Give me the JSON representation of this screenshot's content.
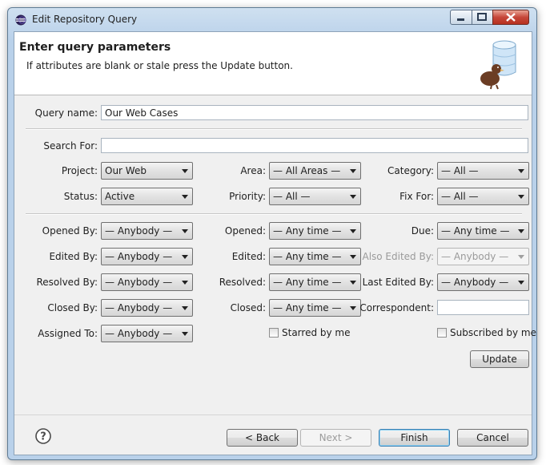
{
  "window": {
    "title": "Edit Repository Query"
  },
  "banner": {
    "title": "Enter query parameters",
    "description": "If attributes are blank or stale press the Update button."
  },
  "query_name": {
    "label": "Query name:",
    "value": "Our Web Cases"
  },
  "search_for": {
    "label": "Search For:",
    "value": ""
  },
  "project": {
    "label": "Project:",
    "value": "Our Web"
  },
  "area": {
    "label": "Area:",
    "value": "— All Areas —"
  },
  "category": {
    "label": "Category:",
    "value": "— All —"
  },
  "status": {
    "label": "Status:",
    "value": "Active"
  },
  "priority": {
    "label": "Priority:",
    "value": "— All —"
  },
  "fix_for": {
    "label": "Fix For:",
    "value": "— All —"
  },
  "opened_by": {
    "label": "Opened By:",
    "value": "— Anybody —"
  },
  "opened": {
    "label": "Opened:",
    "value": "— Any time —"
  },
  "due": {
    "label": "Due:",
    "value": "— Any time —"
  },
  "edited_by": {
    "label": "Edited By:",
    "value": "— Anybody —"
  },
  "edited": {
    "label": "Edited:",
    "value": "— Any time —"
  },
  "also_edited_by": {
    "label": "Also Edited By:",
    "value": "— Anybody —"
  },
  "resolved_by": {
    "label": "Resolved By:",
    "value": "— Anybody —"
  },
  "resolved": {
    "label": "Resolved:",
    "value": "— Any time —"
  },
  "last_edited_by": {
    "label": "Last Edited By:",
    "value": "— Anybody —"
  },
  "closed_by": {
    "label": "Closed By:",
    "value": "— Anybody —"
  },
  "closed": {
    "label": "Closed:",
    "value": "— Any time —"
  },
  "correspondent": {
    "label": "Correspondent:",
    "value": ""
  },
  "assigned_to": {
    "label": "Assigned To:",
    "value": "— Anybody —"
  },
  "starred_by_me": {
    "label": "Starred by me",
    "checked": false
  },
  "subscribed_by_me": {
    "label": "Subscribed by me",
    "checked": false
  },
  "buttons": {
    "update": "Update",
    "back": "< Back",
    "next": "Next >",
    "finish": "Finish",
    "cancel": "Cancel"
  },
  "icons": {
    "app": "eclipse-icon",
    "help": "help-icon",
    "banner": "repository-database-icon"
  }
}
